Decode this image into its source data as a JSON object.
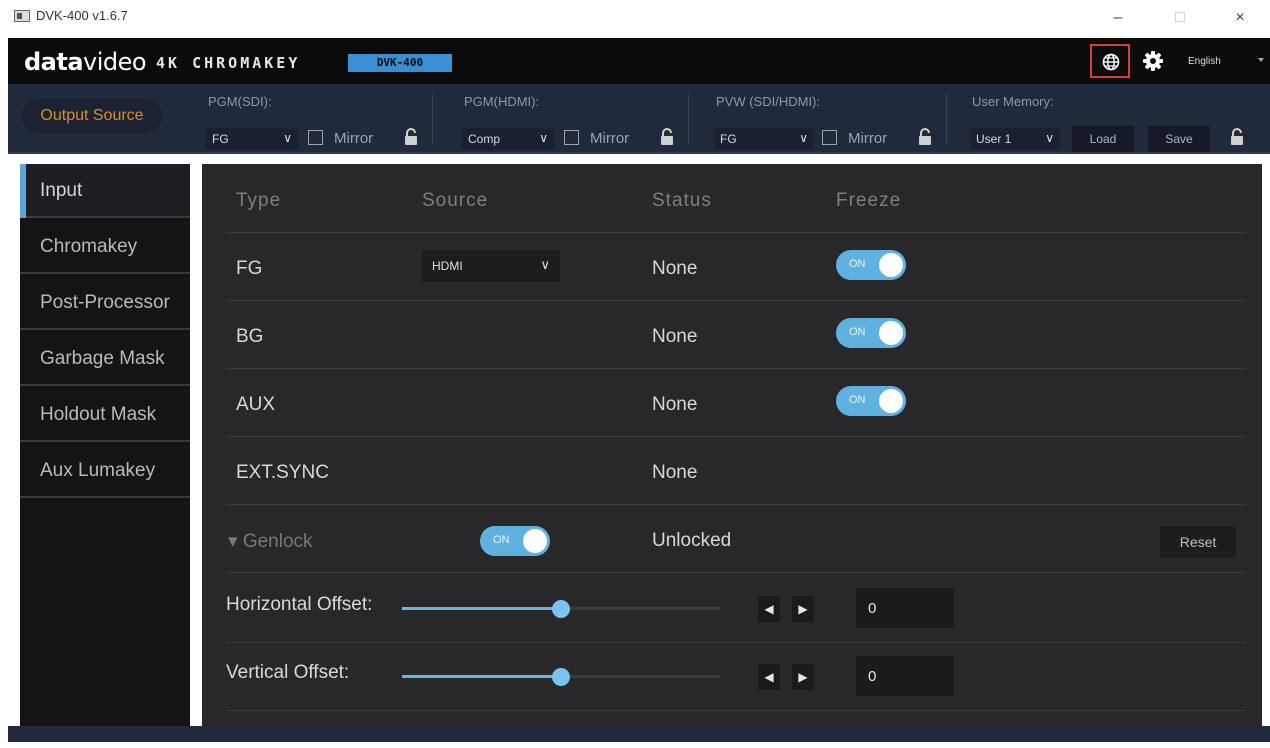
{
  "window": {
    "title": "DVK-400 v1.6.7",
    "minimize": "–",
    "maximize": "□",
    "close": "×"
  },
  "header": {
    "logo_bold": "data",
    "logo_light": "video",
    "product": "4K CHROMAKEY",
    "model": "DVK-400",
    "language": "English",
    "icons": [
      "globe-icon",
      "gear-icon"
    ],
    "highlight_color": "#d93a3a"
  },
  "output_bar": {
    "button": "Output Source",
    "pgm_sdi": {
      "label": "PGM(SDI):",
      "value": "FG",
      "mirror": "Mirror"
    },
    "pgm_hdmi": {
      "label": "PGM(HDMI):",
      "value": "Comp",
      "mirror": "Mirror"
    },
    "pvw": {
      "label": "PVW (SDI/HDMI):",
      "value": "FG",
      "mirror": "Mirror"
    },
    "user_memory": {
      "label": "User Memory:",
      "value": "User 1",
      "load": "Load",
      "save": "Save"
    }
  },
  "sidebar": {
    "items": [
      {
        "label": "Input",
        "active": true
      },
      {
        "label": "Chromakey",
        "active": false
      },
      {
        "label": "Post-Processor",
        "active": false
      },
      {
        "label": "Garbage Mask",
        "active": false
      },
      {
        "label": "Holdout Mask",
        "active": false
      },
      {
        "label": "Aux Lumakey",
        "active": false
      }
    ]
  },
  "input_table": {
    "headers": {
      "type": "Type",
      "source": "Source",
      "status": "Status",
      "freeze": "Freeze"
    },
    "rows": [
      {
        "type": "FG",
        "source": "HDMI",
        "status": "None",
        "freeze": "ON"
      },
      {
        "type": "BG",
        "source": "",
        "status": "None",
        "freeze": "ON"
      },
      {
        "type": "AUX",
        "source": "",
        "status": "None",
        "freeze": "ON"
      },
      {
        "type": "EXT.SYNC",
        "source": "",
        "status": "None",
        "freeze": ""
      }
    ]
  },
  "genlock": {
    "label": "▾ Genlock",
    "toggle": "ON",
    "status": "Unlocked",
    "reset": "Reset",
    "horizontal": {
      "label": "Horizontal Offset:",
      "value": "0",
      "slider_fraction": 0.5
    },
    "vertical": {
      "label": "Vertical Offset:",
      "value": "0",
      "slider_fraction": 0.5
    }
  },
  "colors": {
    "accent": "#5fb2e0",
    "output_source": "#d98c2b",
    "panel": "#28282a",
    "sidebar": "#141416"
  }
}
